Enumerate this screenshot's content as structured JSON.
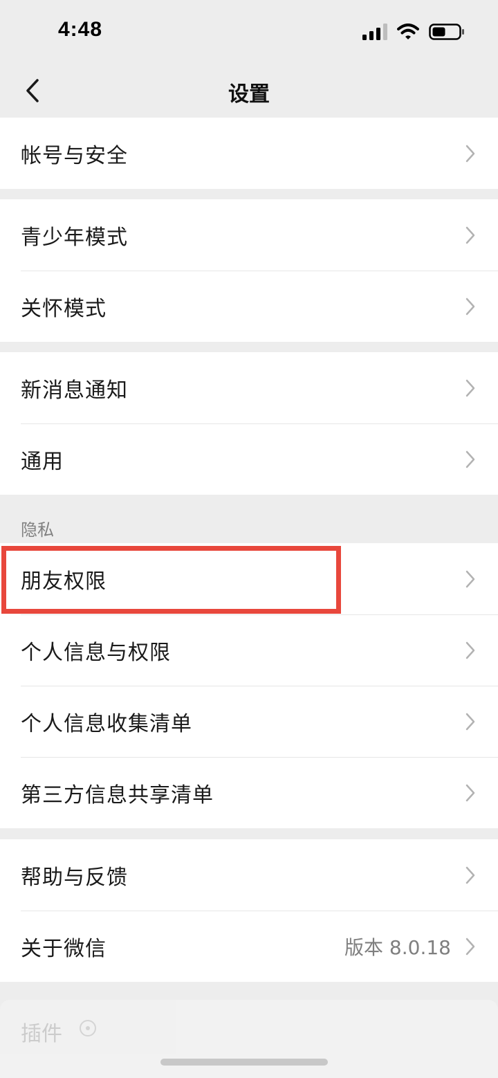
{
  "status": {
    "time": "4:48"
  },
  "nav": {
    "title": "设置"
  },
  "groups": [
    {
      "items": [
        {
          "label": "帐号与安全"
        }
      ]
    },
    {
      "items": [
        {
          "label": "青少年模式"
        },
        {
          "label": "关怀模式"
        }
      ]
    },
    {
      "items": [
        {
          "label": "新消息通知"
        },
        {
          "label": "通用"
        }
      ]
    },
    {
      "header": "隐私",
      "items": [
        {
          "label": "朋友权限"
        },
        {
          "label": "个人信息与权限"
        },
        {
          "label": "个人信息收集清单"
        },
        {
          "label": "第三方信息共享清单"
        }
      ]
    },
    {
      "items": [
        {
          "label": "帮助与反馈"
        },
        {
          "label": "关于微信",
          "value": "版本 8.0.18"
        }
      ]
    }
  ],
  "plugin": {
    "label": "插件"
  },
  "colors": {
    "background": "#ededed",
    "card": "#ffffff",
    "highlight": "#e8473c",
    "secondary_text": "#7f7f7f"
  },
  "icons": [
    "signal-icon",
    "wifi-icon",
    "battery-icon",
    "back-arrow-icon",
    "chevron-right-icon",
    "info-circle-icon"
  ]
}
